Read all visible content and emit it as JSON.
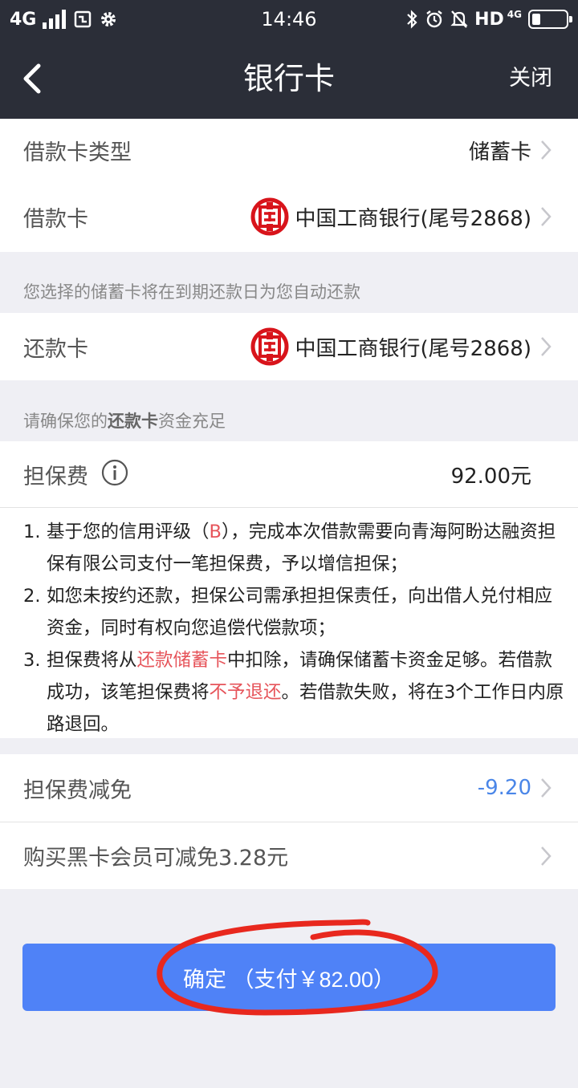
{
  "status_bar": {
    "network": "4G",
    "time": "14:46",
    "hd": "HD",
    "hd_sub": "4G"
  },
  "nav": {
    "title": "银行卡",
    "close_label": "关闭"
  },
  "loan_card_type": {
    "label": "借款卡类型",
    "value": "储蓄卡"
  },
  "loan_card": {
    "label": "借款卡",
    "value": "中国工商银行(尾号2868)"
  },
  "auto_repay_hint": "您选择的储蓄卡将在到期还款日为您自动还款",
  "repay_card": {
    "label": "还款卡",
    "value": "中国工商银行(尾号2868)"
  },
  "funds_hint": {
    "before": "请确保您的",
    "bold": "还款卡",
    "after": "资金充足"
  },
  "guarantee_fee": {
    "label": "担保费",
    "value": "92.00元"
  },
  "notes": [
    {
      "num": "1.",
      "parts": [
        {
          "text": "基于您的信用评级（",
          "red": false
        },
        {
          "text": "B",
          "red": true
        },
        {
          "text": "），完成本次借款需要向青海阿盼达融资担保有限公司支付一笔担保费，予以增信担保；",
          "red": false
        }
      ]
    },
    {
      "num": "2.",
      "parts": [
        {
          "text": "如您未按约还款，担保公司需承担担保责任，向出借人兑付相应资金，同时有权向您追偿代偿款项；",
          "red": false
        }
      ]
    },
    {
      "num": "3.",
      "parts": [
        {
          "text": "担保费将从",
          "red": false
        },
        {
          "text": "还款储蓄卡",
          "red": true
        },
        {
          "text": "中扣除，请确保储蓄卡资金足够。若借款成功，该笔担保费将",
          "red": false
        },
        {
          "text": "不予退还",
          "red": true
        },
        {
          "text": "。若借款失败，将在3个工作日内原路退回。",
          "red": false
        }
      ]
    }
  ],
  "fee_reduction": {
    "label": "担保费减免",
    "value": "-9.20"
  },
  "black_card_offer": {
    "label": "购买黑卡会员可减免3.28元"
  },
  "confirm_button": {
    "label": "确定 （支付￥82.00）"
  },
  "colors": {
    "header_bg": "#2b2e38",
    "button_bg": "#4f82f7",
    "highlight_red": "#e6545a",
    "discount_blue": "#4a86e8",
    "annotation_red": "#e8281e"
  }
}
